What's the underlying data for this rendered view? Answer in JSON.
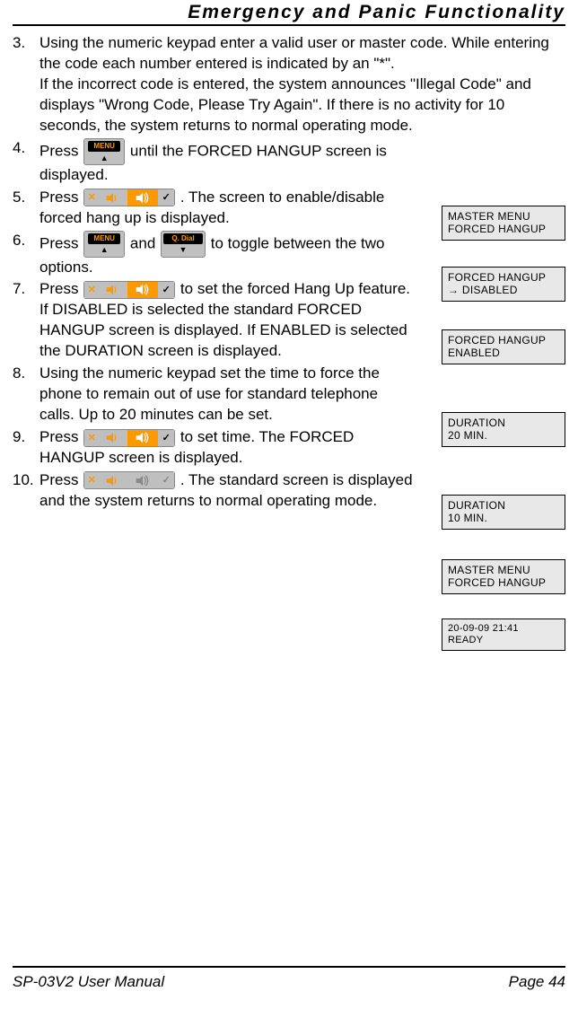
{
  "header": "Emergency and Panic Functionality",
  "steps": [
    {
      "num": "3.",
      "text_full": "Using the numeric keypad enter a valid user or master code. While entering the code each number entered is indicated by an \"*\".\nIf the incorrect code is entered, the system announces \"Illegal Code\" and displays \"Wrong Code, Please Try Again\". If there is no activity for 10 seconds, the system returns to normal operating mode."
    },
    {
      "num": "4.",
      "seg1": "Press ",
      "seg2": " until the FORCED HANGUP screen is displayed."
    },
    {
      "num": "5.",
      "seg1": "Press ",
      "seg2": ". The screen to enable/disable forced hang up is displayed."
    },
    {
      "num": "6.",
      "seg1": "Press ",
      "mid": " and ",
      "seg2": " to toggle between the two options."
    },
    {
      "num": "7.",
      "seg1": "Press ",
      "seg2": " to set the forced Hang Up feature. If DISABLED is selected the standard FORCED HANGUP screen is displayed. If ENABLED is selected the DURATION screen is displayed."
    },
    {
      "num": "8.",
      "text_full": "Using the numeric keypad set the time to force the phone to remain out of use for standard telephone calls. Up to 20 minutes can be set."
    },
    {
      "num": "9.",
      "seg1": "Press ",
      "seg2": " to set time. The FORCED HANGUP screen is displayed."
    },
    {
      "num": "10.",
      "seg1": "Press ",
      "seg2": ". The standard screen is displayed and the system returns to normal operating mode."
    }
  ],
  "screens": {
    "s4": "MASTER MENU\nFORCED HANGUP",
    "s5": "FORCED HANGUP\n→ DISABLED",
    "s6": "FORCED HANGUP\n   ENABLED",
    "s7": "DURATION\n20 MIN.",
    "s8": "DURATION\n10 MIN.",
    "s9": "MASTER MENU\nFORCED HANGUP",
    "s10": "20-09-09  21:41\nREADY"
  },
  "footer": {
    "left": "SP-03V2 User Manual",
    "right": "Page 44"
  }
}
